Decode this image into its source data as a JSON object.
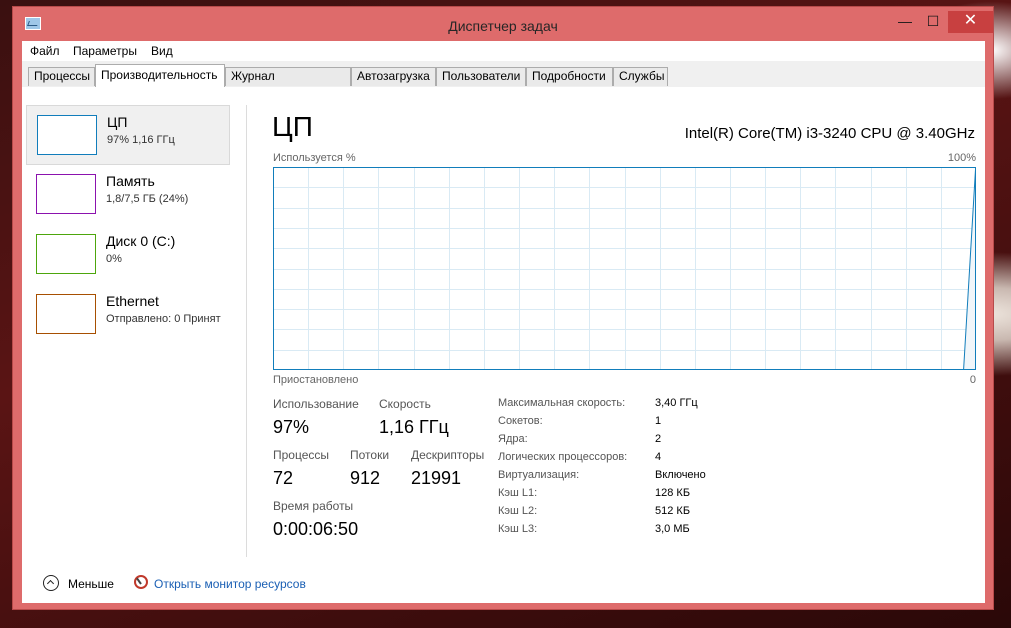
{
  "window": {
    "title": "Диспетчер задач",
    "minimize": "—",
    "maximize": "☐",
    "close": "✕"
  },
  "menu": [
    "Файл",
    "Параметры",
    "Вид"
  ],
  "tabs": [
    "Процессы",
    "Производительность",
    "Журнал приложений",
    "Автозагрузка",
    "Пользователи",
    "Подробности",
    "Службы"
  ],
  "active_tab": "Производительность",
  "sidebar": {
    "items": [
      {
        "name": "ЦП",
        "sub": "97% 1,16 ГГц",
        "color": "#117dbb",
        "selected": true
      },
      {
        "name": "Память",
        "sub": "1,8/7,5 ГБ (24%)",
        "color": "#8b12ae",
        "selected": false
      },
      {
        "name": "Диск 0 (C:)",
        "sub": "0%",
        "color": "#4da60c",
        "selected": false
      },
      {
        "name": "Ethernet",
        "sub": "Отправлено: 0 Принят",
        "color": "#a74f01",
        "selected": false
      }
    ]
  },
  "main": {
    "title": "ЦП",
    "cpu_model": "Intel(R) Core(TM) i3-3240 CPU @ 3.40GHz",
    "graph_top_left": "Используется %",
    "graph_top_right": "100%",
    "graph_bottom_left": "Приостановлено",
    "graph_bottom_right": "0",
    "graph_line_color": "#117dbb",
    "graph_grid_color": "#d9eaf4"
  },
  "chart_data": {
    "type": "area",
    "title": "",
    "ylabel": "Используется %",
    "ylim": [
      0,
      100
    ],
    "series": [
      {
        "values": [
          0,
          0,
          0,
          0,
          0,
          0,
          0,
          0,
          0,
          0,
          0,
          0,
          0,
          0,
          0,
          0,
          0,
          0,
          0,
          0,
          0,
          0,
          0,
          0,
          0,
          0,
          0,
          0,
          0,
          0,
          0,
          0,
          0,
          0,
          0,
          0,
          0,
          0,
          0,
          0,
          0,
          0,
          0,
          0,
          0,
          0,
          0,
          0,
          0,
          0,
          0,
          0,
          0,
          0,
          0,
          0,
          0,
          0,
          0,
          99
        ]
      }
    ]
  },
  "stats": {
    "usage_label": "Использование",
    "usage_value": "97%",
    "speed_label": "Скорость",
    "speed_value": "1,16 ГГц",
    "processes_label": "Процессы",
    "processes_value": "72",
    "threads_label": "Потоки",
    "threads_value": "912",
    "handles_label": "Дескрипторы",
    "handles_value": "21991",
    "uptime_label": "Время работы",
    "uptime_value": "0:00:06:50"
  },
  "details": [
    {
      "label": "Максимальная скорость:",
      "value": "3,40 ГГц"
    },
    {
      "label": "Сокетов:",
      "value": "1"
    },
    {
      "label": "Ядра:",
      "value": "2"
    },
    {
      "label": "Логических процессоров:",
      "value": "4"
    },
    {
      "label": "Виртуализация:",
      "value": "Включено"
    },
    {
      "label": "Кэш L1:",
      "value": "128 КБ"
    },
    {
      "label": "Кэш L2:",
      "value": "512 КБ"
    },
    {
      "label": "Кэш L3:",
      "value": "3,0 МБ"
    }
  ],
  "footer": {
    "fewer_label": "Меньше",
    "monitor_link": "Открыть монитор ресурсов"
  }
}
